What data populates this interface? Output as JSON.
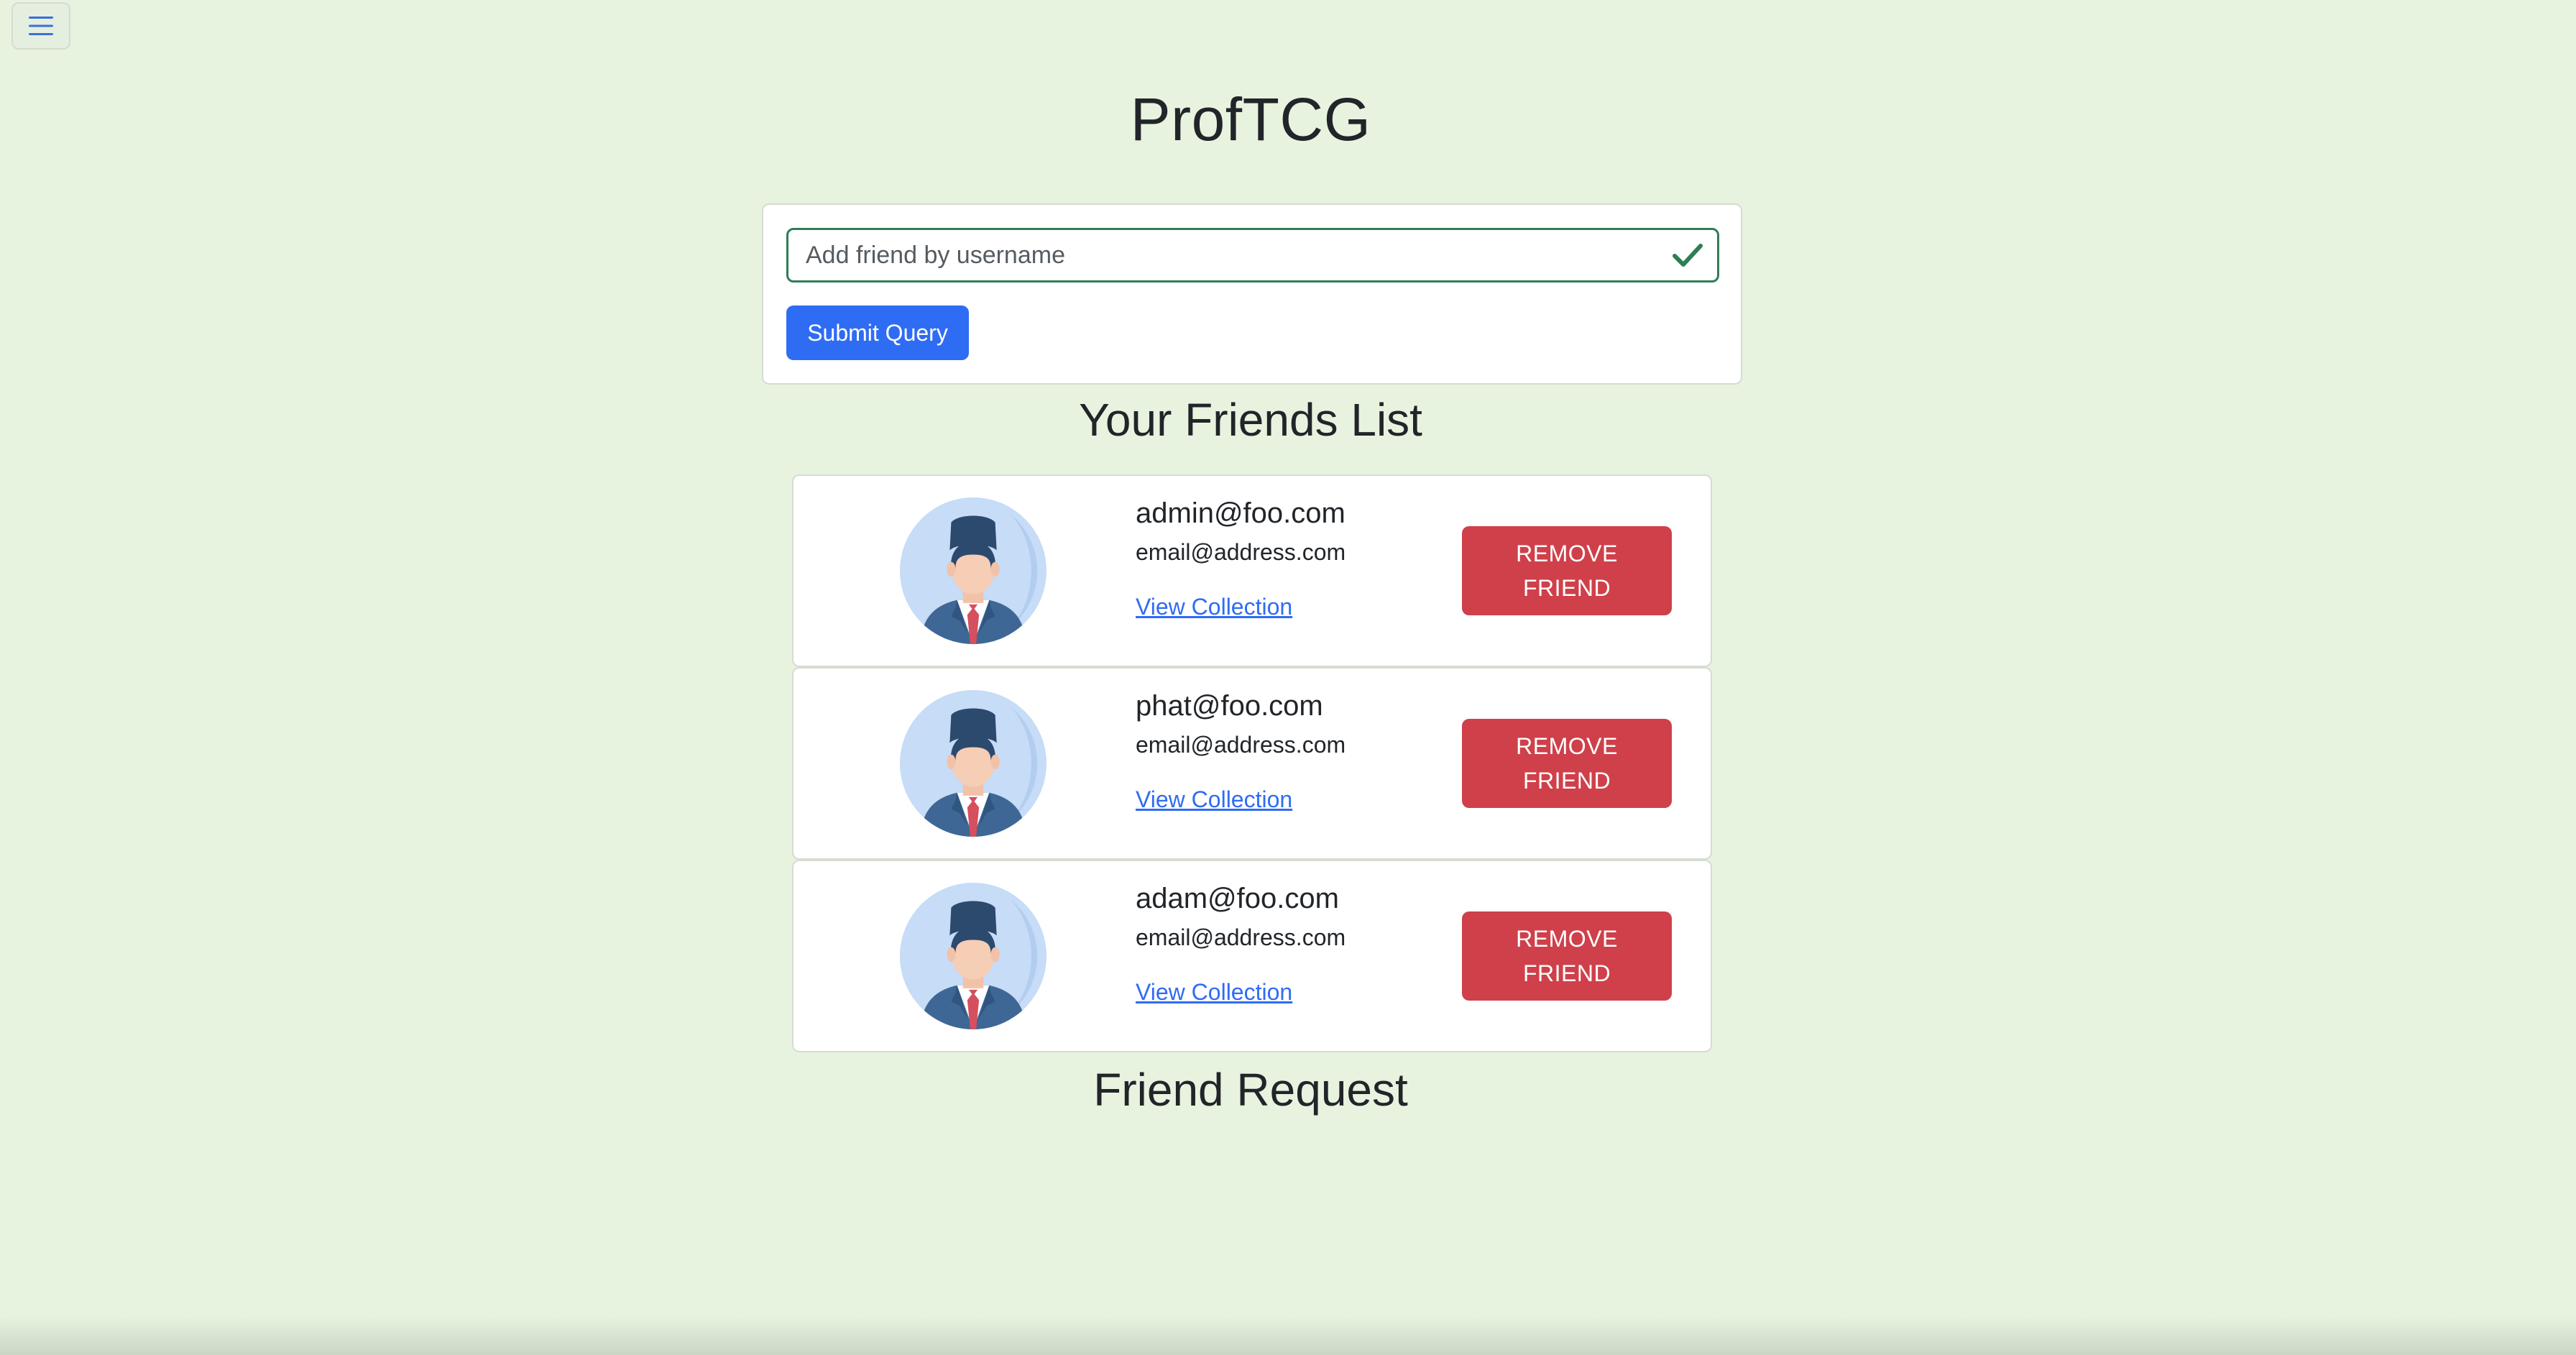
{
  "app": {
    "title": "ProfTCG"
  },
  "nav": {
    "menu_icon": "hamburger-menu-icon"
  },
  "add_friend": {
    "placeholder": "Add friend by username",
    "value": "",
    "valid_icon": "checkmark-icon",
    "submit_label": "Submit Query"
  },
  "friends_section": {
    "heading": "Your Friends List",
    "friends": [
      {
        "username": "admin@foo.com",
        "email": "email@address.com",
        "view_label": "View Collection",
        "remove_label": "REMOVE FRIEND",
        "avatar_icon": "user-avatar-icon"
      },
      {
        "username": "phat@foo.com",
        "email": "email@address.com",
        "view_label": "View Collection",
        "remove_label": "REMOVE FRIEND",
        "avatar_icon": "user-avatar-icon"
      },
      {
        "username": "adam@foo.com",
        "email": "email@address.com",
        "view_label": "View Collection",
        "remove_label": "REMOVE FRIEND",
        "avatar_icon": "user-avatar-icon"
      }
    ]
  },
  "requests_section": {
    "heading": "Friend Request"
  },
  "colors": {
    "page_background": "#e7f3df",
    "primary": "#2f6cf4",
    "danger": "#cf404a",
    "valid": "#2e7d57"
  }
}
